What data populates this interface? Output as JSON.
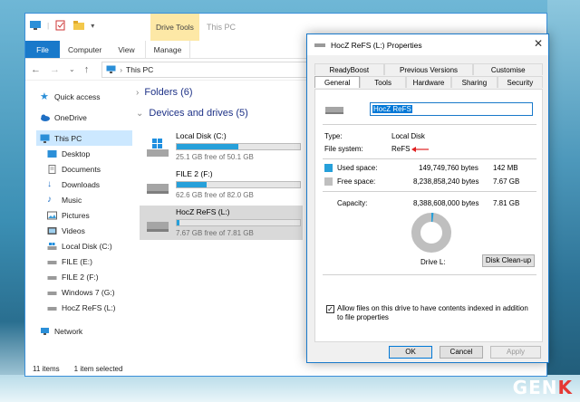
{
  "explorer": {
    "drive_tools_label": "Drive Tools",
    "window_title": "This PC",
    "ribbon_tabs": [
      "File",
      "Computer",
      "View",
      "Manage"
    ],
    "address": "This PC",
    "sidebar": [
      {
        "label": "Quick access",
        "icon": "star-icon"
      },
      {
        "label": "OneDrive",
        "icon": "cloud-icon"
      },
      {
        "label": "This PC",
        "icon": "computer-icon"
      },
      {
        "label": "Desktop",
        "icon": "folder-icon"
      },
      {
        "label": "Documents",
        "icon": "folder-icon"
      },
      {
        "label": "Downloads",
        "icon": "download-icon"
      },
      {
        "label": "Music",
        "icon": "music-icon"
      },
      {
        "label": "Pictures",
        "icon": "picture-icon"
      },
      {
        "label": "Videos",
        "icon": "video-icon"
      },
      {
        "label": "Local Disk (C:)",
        "icon": "drive-icon"
      },
      {
        "label": "FILE (E:)",
        "icon": "drive-icon"
      },
      {
        "label": "FILE 2 (F:)",
        "icon": "drive-icon"
      },
      {
        "label": "Windows 7 (G:)",
        "icon": "drive-icon"
      },
      {
        "label": "HocZ ReFS (L:)",
        "icon": "drive-icon"
      },
      {
        "label": "Network",
        "icon": "network-icon"
      }
    ],
    "folders_header": "Folders (6)",
    "devices_header": "Devices and drives (5)",
    "drives": [
      {
        "name": "Local Disk (C:)",
        "free": "25.1 GB free of 50.1 GB",
        "used_fraction": 0.5
      },
      {
        "name": "FILE 2 (F:)",
        "free": "62.6 GB free of 82.0 GB",
        "used_fraction": 0.24
      },
      {
        "name": "HocZ ReFS (L:)",
        "free": "7.67 GB free of 7.81 GB",
        "used_fraction": 0.02
      }
    ],
    "status_items": "11 items",
    "status_selected": "1 item selected"
  },
  "dialog": {
    "title": "HocZ ReFS (L:) Properties",
    "close": "✕",
    "tabs_top": [
      "ReadyBoost",
      "Previous Versions",
      "Customise"
    ],
    "tabs_bottom": [
      "General",
      "Tools",
      "Hardware",
      "Sharing",
      "Security"
    ],
    "name_value": "HocZ ReFS",
    "type_label": "Type:",
    "type_value": "Local Disk",
    "fs_label": "File system:",
    "fs_value": "ReFS",
    "used_label": "Used space:",
    "used_bytes": "149,749,760 bytes",
    "used_size": "142 MB",
    "free_label": "Free space:",
    "free_bytes": "8,238,858,240 bytes",
    "free_size": "7.67 GB",
    "capacity_label": "Capacity:",
    "capacity_bytes": "8,388,608,000 bytes",
    "capacity_size": "7.81 GB",
    "drive_label": "Drive L:",
    "cleanup_button": "Disk Clean-up",
    "index_checkbox": "Allow files on this drive to have contents indexed in addition to file properties",
    "ok": "OK",
    "cancel": "Cancel",
    "apply": "Apply",
    "used_fraction": 0.0179,
    "colors": {
      "used": "#26a0da",
      "free": "#bfbfbf",
      "arrow": "#e02020"
    }
  },
  "watermark": {
    "prefix": "GEN",
    "suffix": "K"
  }
}
